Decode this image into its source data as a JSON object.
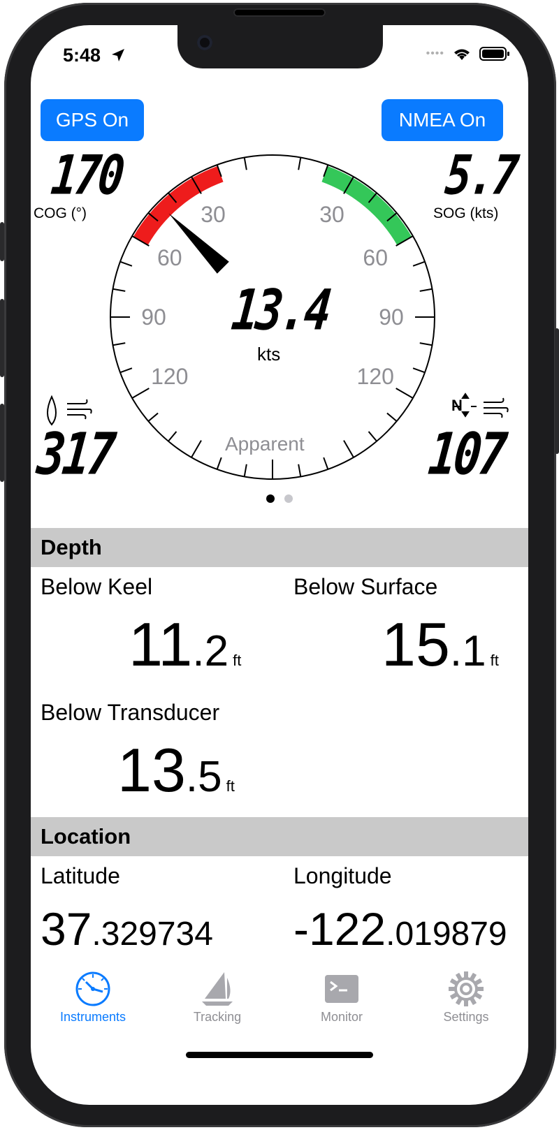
{
  "status": {
    "time": "5:48"
  },
  "buttons": {
    "gps": "GPS On",
    "nmea": "NMEA On"
  },
  "readouts": {
    "cog": {
      "value": "170",
      "label": "COG (°)"
    },
    "sog": {
      "value": "5.7",
      "label": "SOG (kts)"
    },
    "wind_relative": {
      "value": "317"
    },
    "wind_true": {
      "value": "107",
      "north": "N"
    }
  },
  "gauge": {
    "speed": "13.4",
    "unit": "kts",
    "mode": "Apparent",
    "angle_labels": [
      "30",
      "60",
      "90",
      "120"
    ],
    "needle_angle_deg": -45,
    "colors": {
      "port": "#ee1c1c",
      "starboard": "#34c759",
      "needle": "#000000"
    }
  },
  "pager": {
    "count": 2,
    "active": 0
  },
  "depth": {
    "title": "Depth",
    "keel": {
      "label": "Below Keel",
      "int": "11",
      "dec": ".2",
      "unit": "ft"
    },
    "surface": {
      "label": "Below Surface",
      "int": "15",
      "dec": ".1",
      "unit": "ft"
    },
    "transducer": {
      "label": "Below Transducer",
      "int": "13",
      "dec": ".5",
      "unit": "ft"
    }
  },
  "location": {
    "title": "Location",
    "lat": {
      "label": "Latitude",
      "int": "37",
      "dec": ".329734"
    },
    "lon": {
      "label": "Longitude",
      "int": "-122",
      "dec": ".019879"
    }
  },
  "tabs": [
    {
      "label": "Instruments",
      "icon": "gauge-icon",
      "active": true
    },
    {
      "label": "Tracking",
      "icon": "sailboat-icon",
      "active": false
    },
    {
      "label": "Monitor",
      "icon": "terminal-icon",
      "active": false
    },
    {
      "label": "Settings",
      "icon": "gear-icon",
      "active": false
    }
  ],
  "colors": {
    "accent": "#0a7bff",
    "inactive": "#8e8e93",
    "section_bg": "#c9c9c9"
  }
}
